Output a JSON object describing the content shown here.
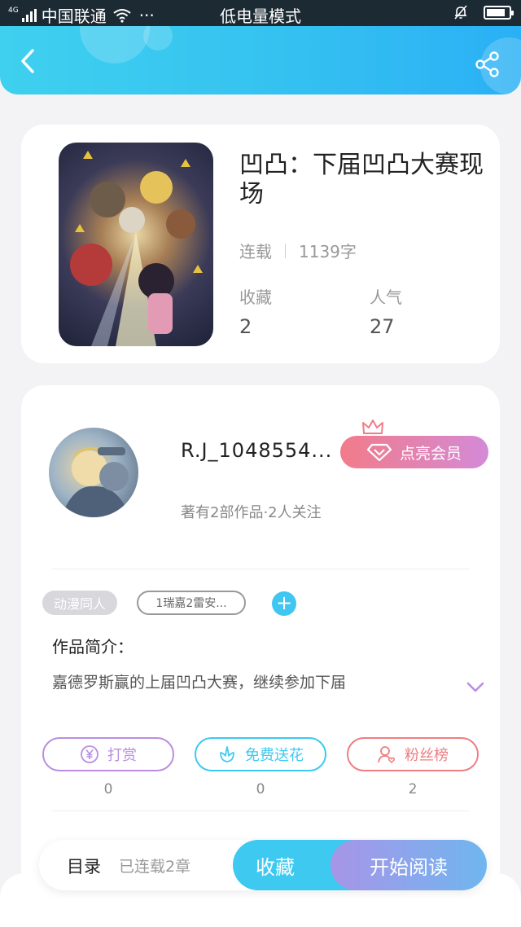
{
  "status_bar": {
    "carrier": "中国联通",
    "network": "4G",
    "more": "···",
    "mode": "低电量模式",
    "battery_level": 0.85
  },
  "header": {
    "back_icon": "chevron-left-icon",
    "share_icon": "share-icon"
  },
  "book": {
    "title": "凹凸：下届凹凸大赛现场",
    "status": "连载",
    "word_count": "1139字",
    "favorites_label": "收藏",
    "favorites_value": "2",
    "popularity_label": "人气",
    "popularity_value": "27"
  },
  "author": {
    "name": "R.J_1048554...",
    "subtitle": "著有2部作品·2人关注",
    "vip_label": "点亮会员"
  },
  "tags": {
    "category": "动漫同人",
    "tag1": "1瑞嘉2雷安...",
    "add": "+"
  },
  "intro": {
    "title": "作品简介：",
    "text": "嘉德罗斯赢的上届凹凸大赛，继续参加下届"
  },
  "actions": [
    {
      "label": "打赏",
      "count": "0",
      "icon": "yen-icon",
      "color": "#b98ee3"
    },
    {
      "label": "免费送花",
      "count": "0",
      "icon": "flower-icon",
      "color": "#3ec9f0"
    },
    {
      "label": "粉丝榜",
      "count": "2",
      "icon": "fan-icon",
      "color": "#ef7d82"
    }
  ],
  "bottom_bar": {
    "toc": "目录",
    "chapters": "已连载2章",
    "favorite": "收藏",
    "read": "开始阅读"
  }
}
